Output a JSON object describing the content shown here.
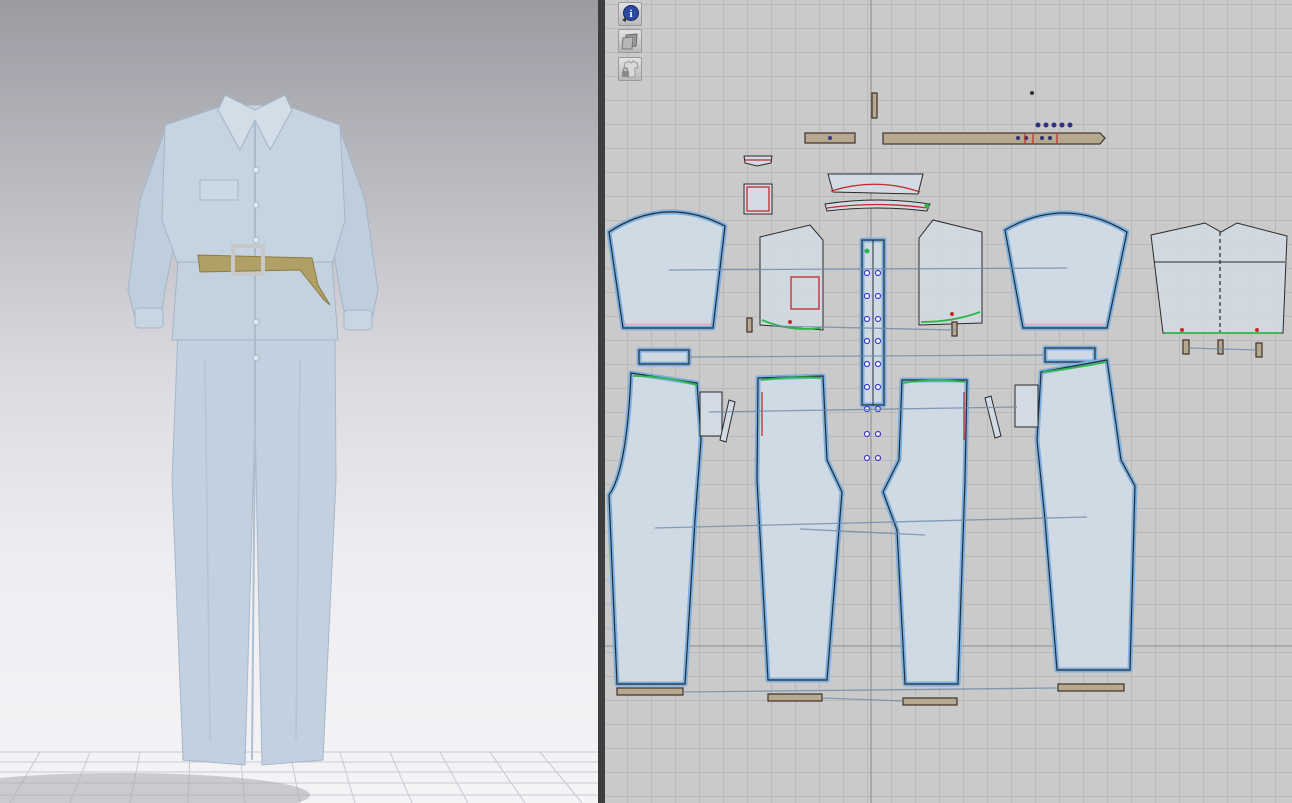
{
  "views": {
    "left": "3d-avatar-view",
    "right": "2d-pattern-window"
  },
  "toolbar_2d": {
    "buttons": [
      {
        "icon": "info-icon"
      },
      {
        "icon": "layers-icon"
      },
      {
        "icon": "locked-garment-icon"
      }
    ]
  },
  "colors": {
    "garment": "#c5d3e2",
    "belt": "#b0a065",
    "pattern_grid_bg": "#cacaca",
    "piece_highlight": "#7fb0dd",
    "seam_green": "#2bb84a",
    "seam_red": "#c42a2a"
  },
  "pattern_pieces": [
    "belt-strap",
    "belt-loop",
    "collar",
    "collar-stand",
    "sleeve-left",
    "sleeve-right",
    "bodice-front-left",
    "bodice-front-right",
    "placket",
    "bodice-back",
    "pocket-flap",
    "chest-pocket",
    "cuff-left",
    "cuff-right",
    "pants-back-left",
    "pants-front-left",
    "pants-front-right",
    "pants-back-right",
    "hem-band-left",
    "hem-band-right"
  ]
}
